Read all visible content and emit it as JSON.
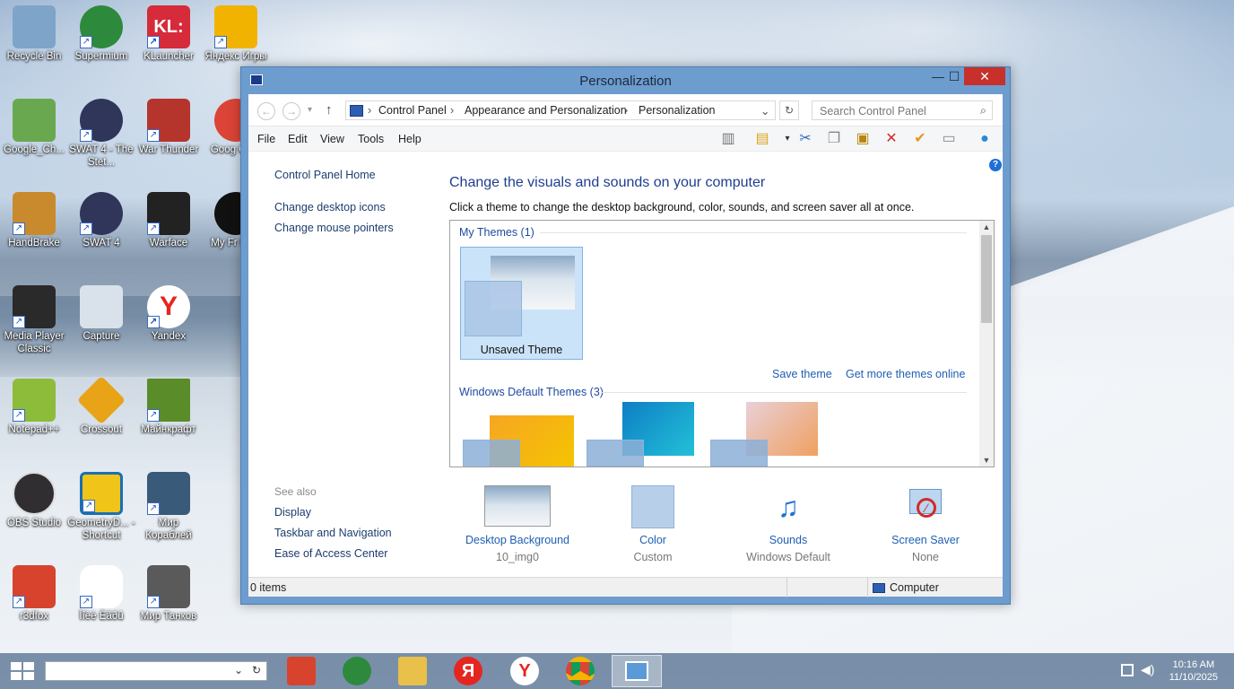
{
  "desktop_icons": [
    {
      "label": "Recycle Bin",
      "color": "#7fa4c9"
    },
    {
      "label": "Supermium",
      "color": "#2d8a3c"
    },
    {
      "label": "KLauncher",
      "color": "#d62b3a"
    },
    {
      "label": "Яндекс Игры",
      "color": "#f2b300"
    },
    {
      "label": "Google_Ch...",
      "color": "#6aa84f"
    },
    {
      "label": "SWAT 4 - The Stet...",
      "color": "#30365a"
    },
    {
      "label": "War Thunder",
      "color": "#b5352d"
    },
    {
      "label": "Goog Chro",
      "color": "#db4437"
    },
    {
      "label": "HandBrake",
      "color": "#c98a2d"
    },
    {
      "label": "SWAT 4",
      "color": "#30365a"
    },
    {
      "label": "Warface",
      "color": "#222222"
    },
    {
      "label": "My Fr Ping",
      "color": "#111111"
    },
    {
      "label": "Media Player Classic",
      "color": "#2a2a2a"
    },
    {
      "label": "Capture",
      "color": "#d9e2ea"
    },
    {
      "label": "Yandex",
      "color": "#e52620"
    },
    {
      "label": "Notepad++",
      "color": "#8cbc3a"
    },
    {
      "label": "Crossout",
      "color": "#e8a317"
    },
    {
      "label": "Майнкрафт",
      "color": "#5b8c2a"
    },
    {
      "label": "OBS Studio",
      "color": "#302e31"
    },
    {
      "label": "GeometryD... - Shortcut",
      "color": "#f0c419"
    },
    {
      "label": "Мир Кораблей",
      "color": "#3a5a7a"
    },
    {
      "label": "r3dfox",
      "color": "#d8432e"
    },
    {
      "label": "Ìîèè Èãðû",
      "color": "#222222"
    },
    {
      "label": "Мир Танков",
      "color": "#5a5a5a"
    }
  ],
  "window": {
    "title": "Personalization",
    "controls": {
      "minimize": "—",
      "maximize": "☐",
      "close": "✕"
    },
    "breadcrumb": [
      "Control Panel",
      "Appearance and Personalization",
      "Personalization"
    ],
    "search_placeholder": "Search Control Panel",
    "menu": [
      "File",
      "Edit",
      "View",
      "Tools",
      "Help"
    ],
    "left_links": [
      "Control Panel Home",
      "Change desktop icons",
      "Change mouse pointers"
    ],
    "see_also_label": "See also",
    "see_also": [
      "Display",
      "Taskbar and Navigation",
      "Ease of Access Center"
    ],
    "heading": "Change the visuals and sounds on your computer",
    "subheading": "Click a theme to change the desktop background, color, sounds, and screen saver all at once.",
    "my_themes_label": "My Themes (1)",
    "unsaved_theme": "Unsaved Theme",
    "save_theme": "Save theme",
    "get_more": "Get more themes online",
    "default_themes_label": "Windows Default Themes (3)",
    "tiles": [
      {
        "label": "Desktop Background",
        "value": "10_img0"
      },
      {
        "label": "Color",
        "value": "Custom"
      },
      {
        "label": "Sounds",
        "value": "Windows Default"
      },
      {
        "label": "Screen Saver",
        "value": "None"
      }
    ],
    "status_items": "0 items",
    "status_location": "Computer"
  },
  "taskbar": {
    "time": "10:16 AM",
    "date": "11/10/2025"
  }
}
